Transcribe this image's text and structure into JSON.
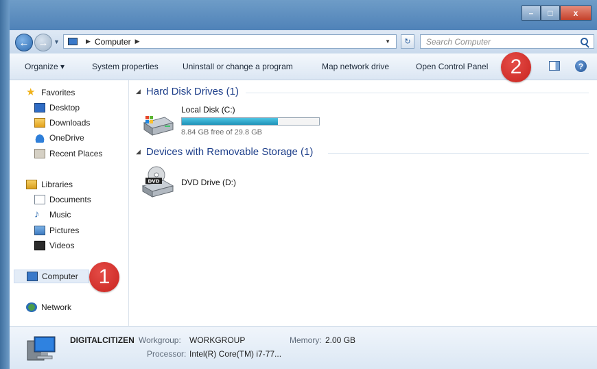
{
  "window": {
    "minimize_label": "–",
    "maximize_label": "□",
    "close_label": "x"
  },
  "address": {
    "crumb": "Computer",
    "search_placeholder": "Search Computer"
  },
  "toolbar": {
    "organize": "Organize ▾",
    "system_properties": "System properties",
    "uninstall": "Uninstall or change a program",
    "map_drive": "Map network drive",
    "control_panel": "Open Control Panel",
    "help_label": "?"
  },
  "badges": {
    "one": "1",
    "two": "2"
  },
  "sidebar": {
    "favorites": "Favorites",
    "desktop": "Desktop",
    "downloads": "Downloads",
    "onedrive": "OneDrive",
    "recent": "Recent Places",
    "libraries": "Libraries",
    "documents": "Documents",
    "music": "Music",
    "pictures": "Pictures",
    "videos": "Videos",
    "computer": "Computer",
    "network": "Network"
  },
  "content": {
    "hdd_group": "Hard Disk Drives (1)",
    "local_disk": "Local Disk (C:)",
    "local_disk_free": "8.84 GB free of 29.8 GB",
    "local_disk_used_fraction": 0.7,
    "removable_group": "Devices with Removable Storage (1)",
    "dvd_drive": "DVD Drive (D:)",
    "dvd_badge": "DVD"
  },
  "details": {
    "computer_name": "DIGITALCITIZEN",
    "workgroup_label": "Workgroup:",
    "workgroup_value": "WORKGROUP",
    "memory_label": "Memory:",
    "memory_value": "2.00 GB",
    "processor_label": "Processor:",
    "processor_value": "Intel(R) Core(TM) i7-77..."
  }
}
